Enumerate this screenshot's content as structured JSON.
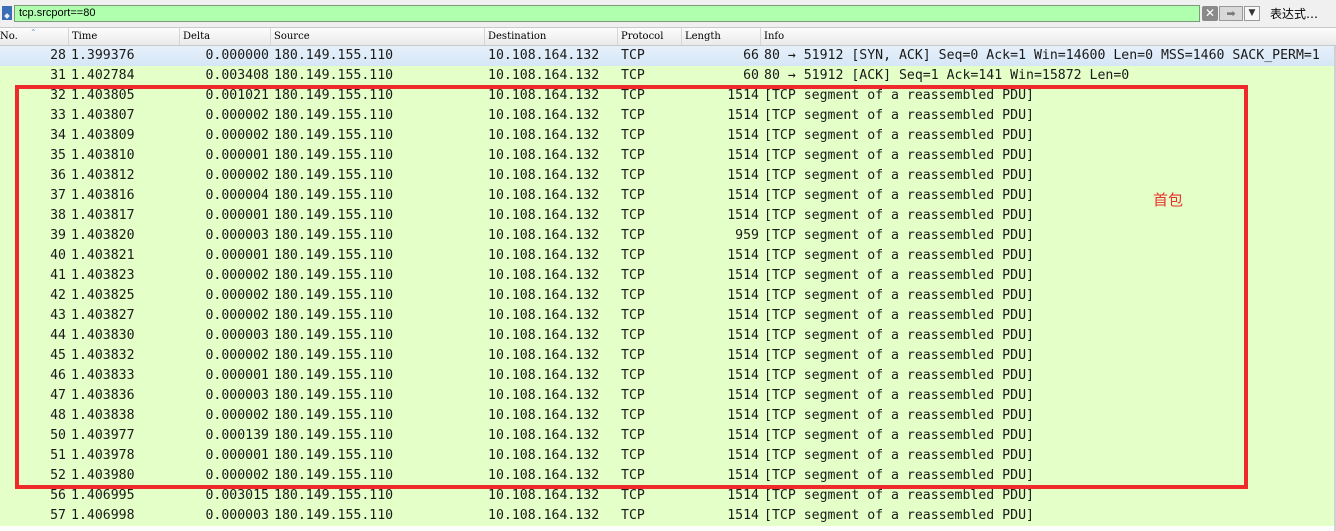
{
  "filter": {
    "value": "tcp.srcport==80",
    "clear_icon": "clear-icon",
    "apply_icon": "arrow-right-icon",
    "dropdown_icon": "chevron-down-icon",
    "expression_label": "表达式…"
  },
  "columns": [
    "No.",
    "Time",
    "Delta",
    "Source",
    "Destination",
    "Protocol",
    "Length",
    "Info"
  ],
  "packets": [
    {
      "no": "28",
      "time": "1.399376",
      "delta": "0.000000",
      "src": "180.149.155.110",
      "dst": "10.108.164.132",
      "proto": "TCP",
      "len": "66",
      "info": "80 → 51912 [SYN, ACK] Seq=0 Ack=1 Win=14600 Len=0 MSS=1460 SACK_PERM=1"
    },
    {
      "no": "31",
      "time": "1.402784",
      "delta": "0.003408",
      "src": "180.149.155.110",
      "dst": "10.108.164.132",
      "proto": "TCP",
      "len": "60",
      "info": "80 → 51912 [ACK] Seq=1 Ack=141 Win=15872 Len=0"
    },
    {
      "no": "32",
      "time": "1.403805",
      "delta": "0.001021",
      "src": "180.149.155.110",
      "dst": "10.108.164.132",
      "proto": "TCP",
      "len": "1514",
      "info": "[TCP segment of a reassembled PDU]"
    },
    {
      "no": "33",
      "time": "1.403807",
      "delta": "0.000002",
      "src": "180.149.155.110",
      "dst": "10.108.164.132",
      "proto": "TCP",
      "len": "1514",
      "info": "[TCP segment of a reassembled PDU]"
    },
    {
      "no": "34",
      "time": "1.403809",
      "delta": "0.000002",
      "src": "180.149.155.110",
      "dst": "10.108.164.132",
      "proto": "TCP",
      "len": "1514",
      "info": "[TCP segment of a reassembled PDU]"
    },
    {
      "no": "35",
      "time": "1.403810",
      "delta": "0.000001",
      "src": "180.149.155.110",
      "dst": "10.108.164.132",
      "proto": "TCP",
      "len": "1514",
      "info": "[TCP segment of a reassembled PDU]"
    },
    {
      "no": "36",
      "time": "1.403812",
      "delta": "0.000002",
      "src": "180.149.155.110",
      "dst": "10.108.164.132",
      "proto": "TCP",
      "len": "1514",
      "info": "[TCP segment of a reassembled PDU]"
    },
    {
      "no": "37",
      "time": "1.403816",
      "delta": "0.000004",
      "src": "180.149.155.110",
      "dst": "10.108.164.132",
      "proto": "TCP",
      "len": "1514",
      "info": "[TCP segment of a reassembled PDU]"
    },
    {
      "no": "38",
      "time": "1.403817",
      "delta": "0.000001",
      "src": "180.149.155.110",
      "dst": "10.108.164.132",
      "proto": "TCP",
      "len": "1514",
      "info": "[TCP segment of a reassembled PDU]"
    },
    {
      "no": "39",
      "time": "1.403820",
      "delta": "0.000003",
      "src": "180.149.155.110",
      "dst": "10.108.164.132",
      "proto": "TCP",
      "len": "959",
      "info": "[TCP segment of a reassembled PDU]"
    },
    {
      "no": "40",
      "time": "1.403821",
      "delta": "0.000001",
      "src": "180.149.155.110",
      "dst": "10.108.164.132",
      "proto": "TCP",
      "len": "1514",
      "info": "[TCP segment of a reassembled PDU]"
    },
    {
      "no": "41",
      "time": "1.403823",
      "delta": "0.000002",
      "src": "180.149.155.110",
      "dst": "10.108.164.132",
      "proto": "TCP",
      "len": "1514",
      "info": "[TCP segment of a reassembled PDU]"
    },
    {
      "no": "42",
      "time": "1.403825",
      "delta": "0.000002",
      "src": "180.149.155.110",
      "dst": "10.108.164.132",
      "proto": "TCP",
      "len": "1514",
      "info": "[TCP segment of a reassembled PDU]"
    },
    {
      "no": "43",
      "time": "1.403827",
      "delta": "0.000002",
      "src": "180.149.155.110",
      "dst": "10.108.164.132",
      "proto": "TCP",
      "len": "1514",
      "info": "[TCP segment of a reassembled PDU]"
    },
    {
      "no": "44",
      "time": "1.403830",
      "delta": "0.000003",
      "src": "180.149.155.110",
      "dst": "10.108.164.132",
      "proto": "TCP",
      "len": "1514",
      "info": "[TCP segment of a reassembled PDU]"
    },
    {
      "no": "45",
      "time": "1.403832",
      "delta": "0.000002",
      "src": "180.149.155.110",
      "dst": "10.108.164.132",
      "proto": "TCP",
      "len": "1514",
      "info": "[TCP segment of a reassembled PDU]"
    },
    {
      "no": "46",
      "time": "1.403833",
      "delta": "0.000001",
      "src": "180.149.155.110",
      "dst": "10.108.164.132",
      "proto": "TCP",
      "len": "1514",
      "info": "[TCP segment of a reassembled PDU]"
    },
    {
      "no": "47",
      "time": "1.403836",
      "delta": "0.000003",
      "src": "180.149.155.110",
      "dst": "10.108.164.132",
      "proto": "TCP",
      "len": "1514",
      "info": "[TCP segment of a reassembled PDU]"
    },
    {
      "no": "48",
      "time": "1.403838",
      "delta": "0.000002",
      "src": "180.149.155.110",
      "dst": "10.108.164.132",
      "proto": "TCP",
      "len": "1514",
      "info": "[TCP segment of a reassembled PDU]"
    },
    {
      "no": "50",
      "time": "1.403977",
      "delta": "0.000139",
      "src": "180.149.155.110",
      "dst": "10.108.164.132",
      "proto": "TCP",
      "len": "1514",
      "info": "[TCP segment of a reassembled PDU]"
    },
    {
      "no": "51",
      "time": "1.403978",
      "delta": "0.000001",
      "src": "180.149.155.110",
      "dst": "10.108.164.132",
      "proto": "TCP",
      "len": "1514",
      "info": "[TCP segment of a reassembled PDU]"
    },
    {
      "no": "52",
      "time": "1.403980",
      "delta": "0.000002",
      "src": "180.149.155.110",
      "dst": "10.108.164.132",
      "proto": "TCP",
      "len": "1514",
      "info": "[TCP segment of a reassembled PDU]"
    },
    {
      "no": "56",
      "time": "1.406995",
      "delta": "0.003015",
      "src": "180.149.155.110",
      "dst": "10.108.164.132",
      "proto": "TCP",
      "len": "1514",
      "info": "[TCP segment of a reassembled PDU]"
    },
    {
      "no": "57",
      "time": "1.406998",
      "delta": "0.000003",
      "src": "180.149.155.110",
      "dst": "10.108.164.132",
      "proto": "TCP",
      "len": "1514",
      "info": "[TCP segment of a reassembled PDU]"
    }
  ],
  "annotation": {
    "label": "首包",
    "color": "#e8322e"
  },
  "colors": {
    "row_bg": "#e4ffc7",
    "filter_bg": "#afffaf",
    "highlight_box": "#ee2a2a"
  }
}
